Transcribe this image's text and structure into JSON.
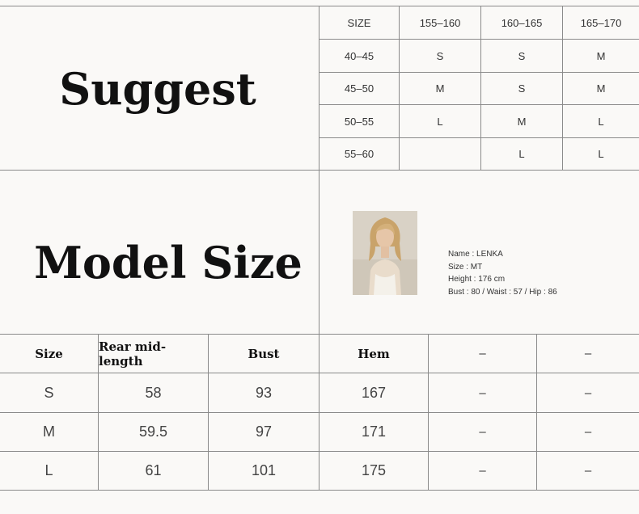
{
  "suggest": {
    "title": "Suggest",
    "header": [
      "SIZE",
      "155–160",
      "160–165",
      "165–170"
    ],
    "rows": [
      {
        "weight": "40–45",
        "cells": [
          "S",
          "S",
          "M"
        ]
      },
      {
        "weight": "45–50",
        "cells": [
          "M",
          "S",
          "M"
        ]
      },
      {
        "weight": "50–55",
        "cells": [
          "L",
          "M",
          "L"
        ]
      },
      {
        "weight": "55–60",
        "cells": [
          "",
          "L",
          "L"
        ]
      }
    ]
  },
  "model": {
    "title": "Model Size",
    "photo_icon": "model-photo",
    "name": "Name : LENKA",
    "size": "Size : MT",
    "height": "Height : 176 cm",
    "measurements": "Bust : 80 / Waist : 57 / Hip : 86"
  },
  "size_table": {
    "headers": [
      "Size",
      "Rear mid-length",
      "Bust",
      "Hem",
      "–",
      "–"
    ],
    "rows": [
      [
        "S",
        "58",
        "93",
        "167",
        "–",
        "–"
      ],
      [
        "M",
        "59.5",
        "97",
        "171",
        "–",
        "–"
      ],
      [
        "L",
        "61",
        "101",
        "175",
        "–",
        "–"
      ]
    ]
  }
}
